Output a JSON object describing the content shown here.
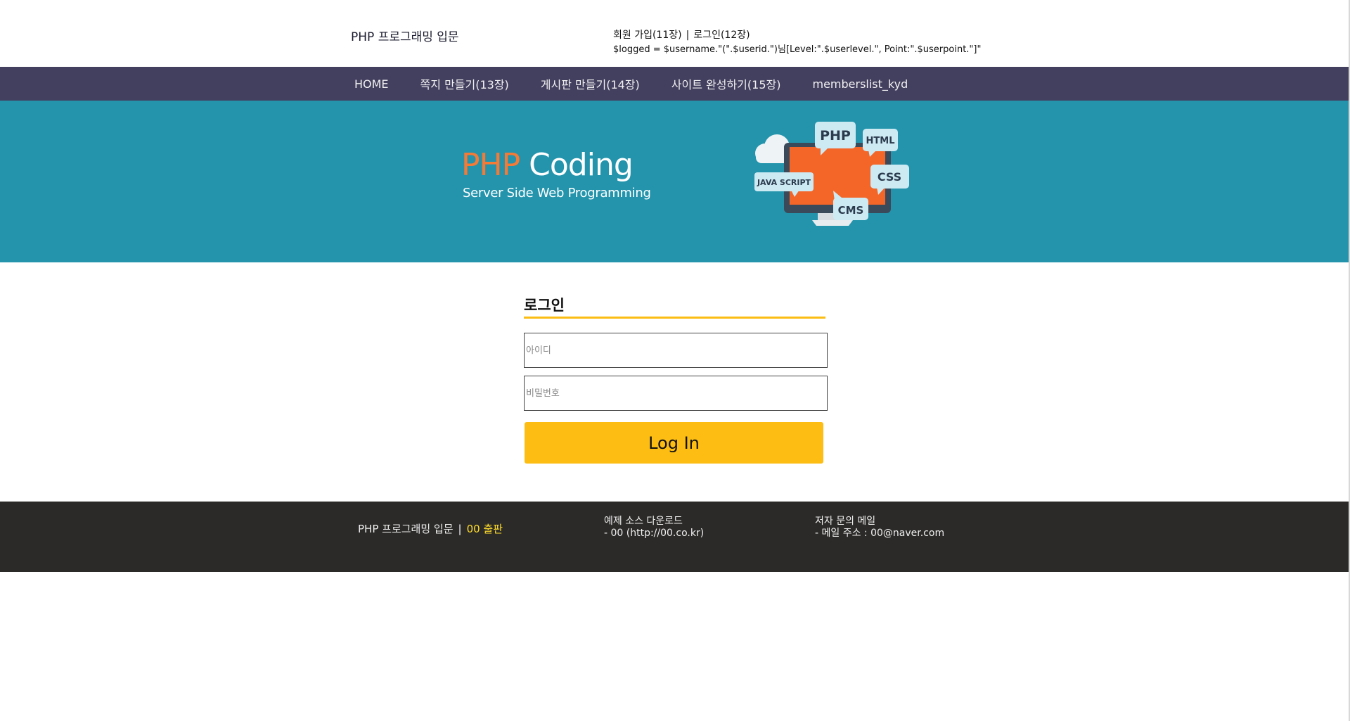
{
  "header": {
    "site_title": "PHP 프로그래밍 입문",
    "join_link": "회원 가입(11장)",
    "separator": "|",
    "login_link": "로그인(12장)",
    "logged_text": "$logged = $username.\"(\".$userid.\")님[Level:\".$userlevel.\", Point:\".$userpoint.\"]\""
  },
  "nav": {
    "items": [
      "HOME",
      "쪽지 만들기(13장)",
      "게시판 만들기(14장)",
      "사이트 완성하기(15장)",
      "memberslist_kyd"
    ]
  },
  "banner": {
    "logo_php": "PHP",
    "logo_coding": "Coding",
    "subtitle": "Server Side Web Programming",
    "bubble_php": "PHP",
    "bubble_html": "HTML",
    "bubble_css": "CSS",
    "bubble_js": "JAVA SCRIPT",
    "bubble_cms": "CMS"
  },
  "login": {
    "title": "로그인",
    "id_placeholder": "아이디",
    "pw_placeholder": "비밀번호",
    "button_label": "Log In"
  },
  "footer": {
    "book_title": "PHP 프로그래밍 입문",
    "separator": "|",
    "publisher": "00 출판",
    "download_title": "예제 소스 다운로드",
    "download_line": "- 00 (http://00.co.kr)",
    "mail_title": "저자 문의 메일",
    "mail_line": "- 메일 주소 : 00@naver.com"
  },
  "colors": {
    "nav_bg": "#433f5f",
    "banner_bg": "#2394ac",
    "accent": "#fdbd13",
    "footer_bg": "#2b2a28",
    "logo_orange": "#f47a36"
  }
}
